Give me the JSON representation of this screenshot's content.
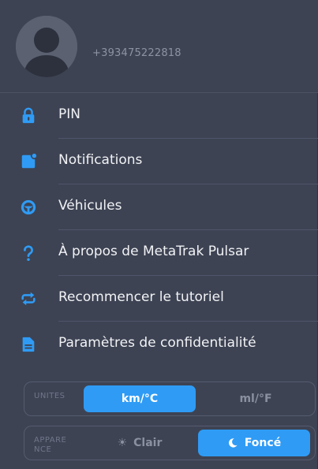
{
  "profile": {
    "phone": "+393475222818"
  },
  "menu": {
    "items": [
      {
        "label": "PIN",
        "icon": "lock-icon"
      },
      {
        "label": "Notifications",
        "icon": "notification-icon"
      },
      {
        "label": "Véhicules",
        "icon": "steering-wheel-icon"
      },
      {
        "label": "À propos de MetaTrak Pulsar",
        "icon": "question-icon"
      },
      {
        "label": "Recommencer le tutoriel",
        "icon": "repeat-icon"
      },
      {
        "label": "Paramètres de confidentialité",
        "icon": "document-icon"
      }
    ]
  },
  "units": {
    "caption": "UNITES",
    "options": [
      "km/°C",
      "ml/°F"
    ],
    "selected": "km/°C"
  },
  "appearance": {
    "caption": "APPARE NCE",
    "options": [
      "Clair",
      "Foncé"
    ],
    "selected": "Foncé"
  },
  "colors": {
    "background": "#3d4353",
    "accent": "#2f9bf5",
    "text": "#f1f2f5",
    "muted": "#8d93a3"
  }
}
